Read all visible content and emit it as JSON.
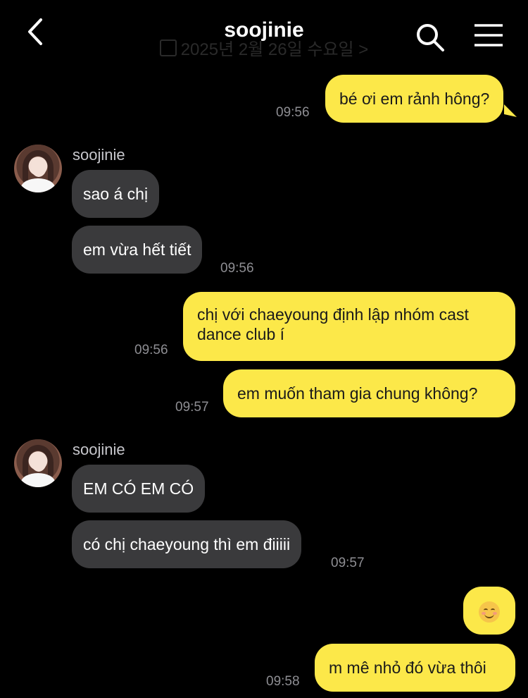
{
  "header": {
    "title": "soojinie",
    "date_label": "2025년 2월 26일 수요일 >"
  },
  "messages": [
    {
      "dir": "out",
      "text": "bé ơi em rảnh hông?",
      "time": "09:56"
    },
    {
      "dir": "in",
      "sender": "soojinie",
      "text": "sao á chị"
    },
    {
      "dir": "in",
      "text": "em vừa hết tiết",
      "time": "09:56"
    },
    {
      "dir": "out",
      "text": "chị với chaeyoung định lập nhóm cast dance club í",
      "time": "09:56"
    },
    {
      "dir": "out",
      "text": "em muốn tham gia chung không?",
      "time": "09:57"
    },
    {
      "dir": "in",
      "sender": "soojinie",
      "text": "EM CÓ EM CÓ"
    },
    {
      "dir": "in",
      "text": "có chị chaeyoung thì em điiiii",
      "time": "09:57"
    },
    {
      "dir": "out",
      "emoji": "smiling-face-emoji"
    },
    {
      "dir": "out",
      "text": "m mê nhỏ đó vừa thôi",
      "time": "09:58"
    }
  ],
  "colors": {
    "background": "#000000",
    "outgoing_bubble": "#fce849",
    "incoming_bubble": "#3a3a3c",
    "timestamp": "#8e8e93"
  },
  "icons": [
    "back-icon",
    "search-icon",
    "menu-icon",
    "calendar-icon",
    "avatar",
    "smiling-face-emoji"
  ]
}
